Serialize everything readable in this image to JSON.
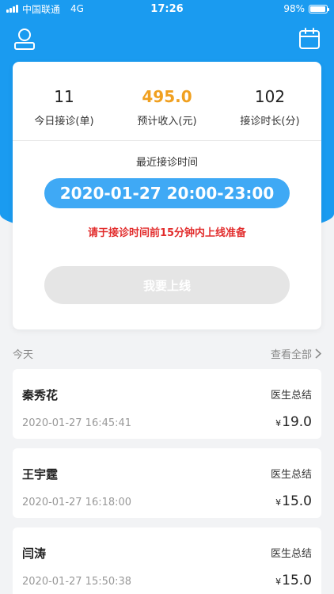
{
  "status_bar": {
    "carrier": "中国联通",
    "network": "4G",
    "time": "17:26",
    "battery": "98%",
    "battery_level": 0.98
  },
  "header": {
    "left_icon": "user-icon",
    "right_icon": "calendar-icon"
  },
  "stats": [
    {
      "value": "11",
      "label": "今日接诊(单)"
    },
    {
      "value": "495.0",
      "label": "预计收入(元)"
    },
    {
      "value": "102",
      "label": "接诊时长(分)"
    }
  ],
  "recent": {
    "title": "最近接诊时间",
    "time_range": "2020-01-27 20:00-23:00",
    "warning": "请于接诊时间前15分钟内上线准备",
    "online_button": "我要上线"
  },
  "today": {
    "label": "今天",
    "see_all": "查看全部"
  },
  "consultations": [
    {
      "name": "秦秀花",
      "tag": "医生总结",
      "datetime": "2020-01-27 16:45:41",
      "currency": "¥",
      "amount": "19.0"
    },
    {
      "name": "王宇霆",
      "tag": "医生总结",
      "datetime": "2020-01-27 16:18:00",
      "currency": "¥",
      "amount": "15.0"
    },
    {
      "name": "闫涛",
      "tag": "医生总结",
      "datetime": "2020-01-27 15:50:38",
      "currency": "¥",
      "amount": "15.0"
    }
  ],
  "colors": {
    "primary": "#1a9bf0",
    "pill": "#3fa9f5",
    "income": "#f0a020",
    "warning": "#e22d2d"
  }
}
